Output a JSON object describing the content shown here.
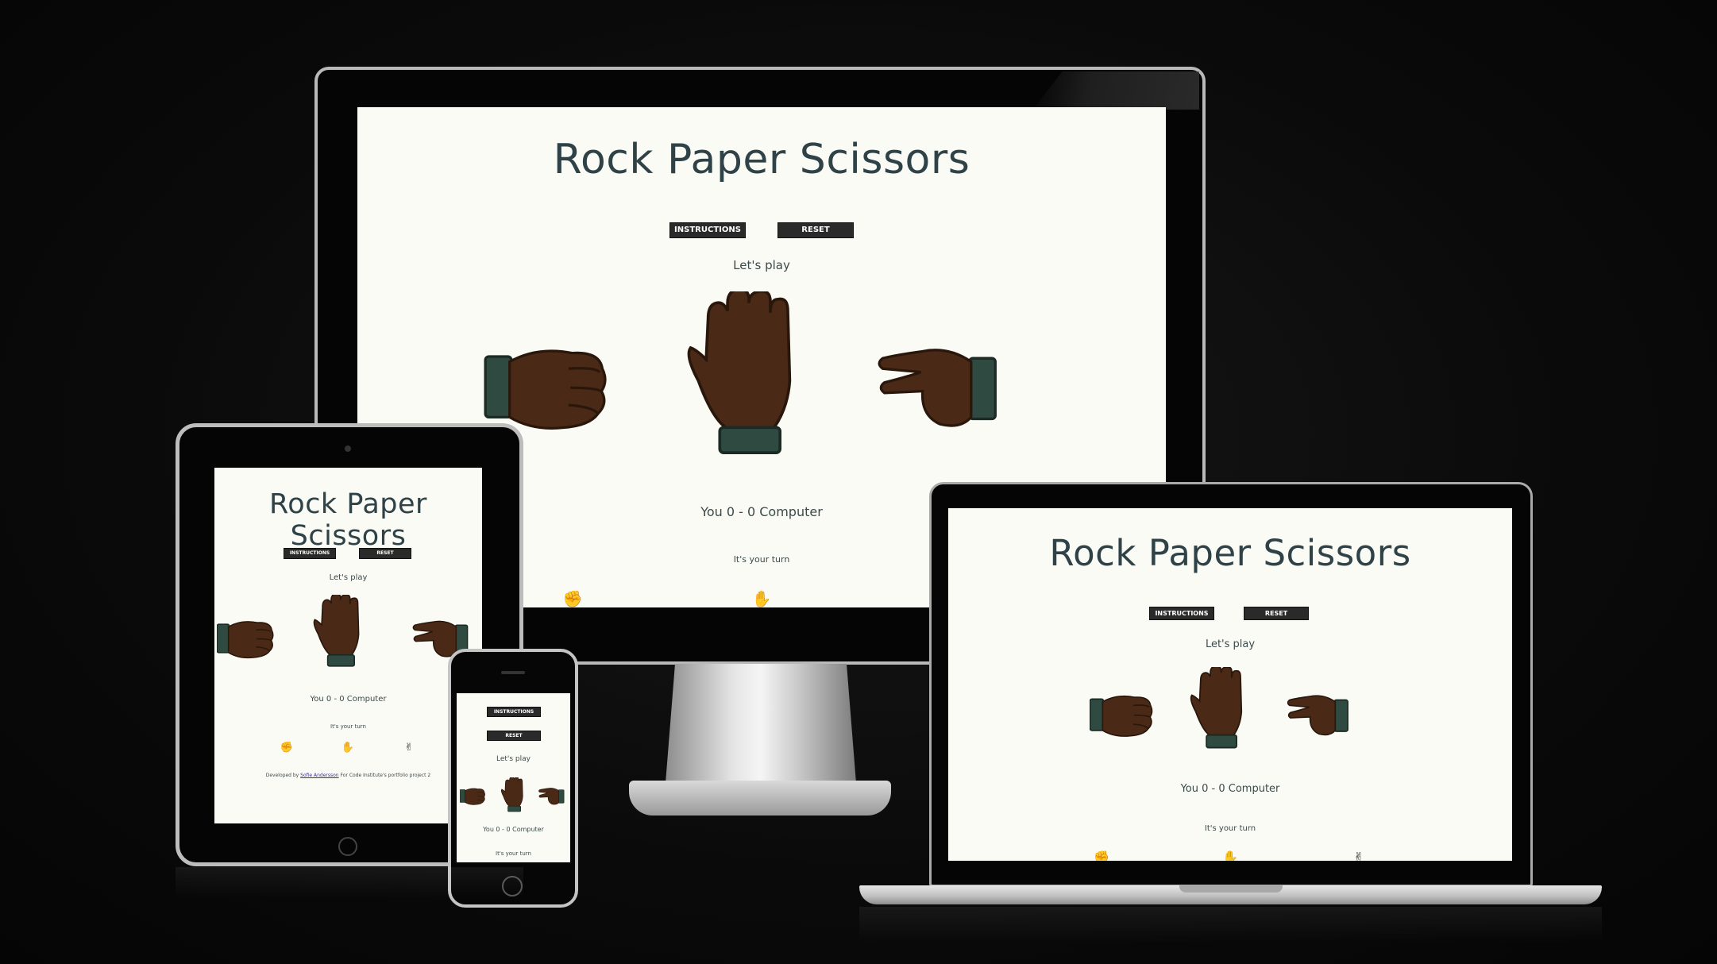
{
  "app": {
    "title": "Rock Paper Scissors"
  },
  "buttons": {
    "instructions": "INSTRUCTIONS",
    "reset": "RESET"
  },
  "status": {
    "prompt": "Let's play",
    "turn": "It's your turn"
  },
  "score": {
    "text": "You 0 - 0 Computer",
    "you": 0,
    "computer": 0
  },
  "footer": {
    "prefix": "Developed by",
    "author": "Sofie Andersson",
    "suffix": "For Code Institute's portfolio project 2"
  },
  "choices": [
    {
      "name": "rock",
      "icon": "rock-hand-icon",
      "symbol": "✊"
    },
    {
      "name": "paper",
      "icon": "paper-hand-icon",
      "symbol": "✋"
    },
    {
      "name": "scissors",
      "icon": "scissors-hand-icon",
      "symbol": "✌"
    }
  ],
  "colors": {
    "background": "#0b0b0b",
    "screen": "#fbfbf6",
    "title": "#2e4247",
    "button": "#2a2a2a",
    "skin": "#4a2a17",
    "cuff": "#2f4a40"
  },
  "devices": [
    "monitor",
    "tablet",
    "laptop",
    "phone"
  ]
}
